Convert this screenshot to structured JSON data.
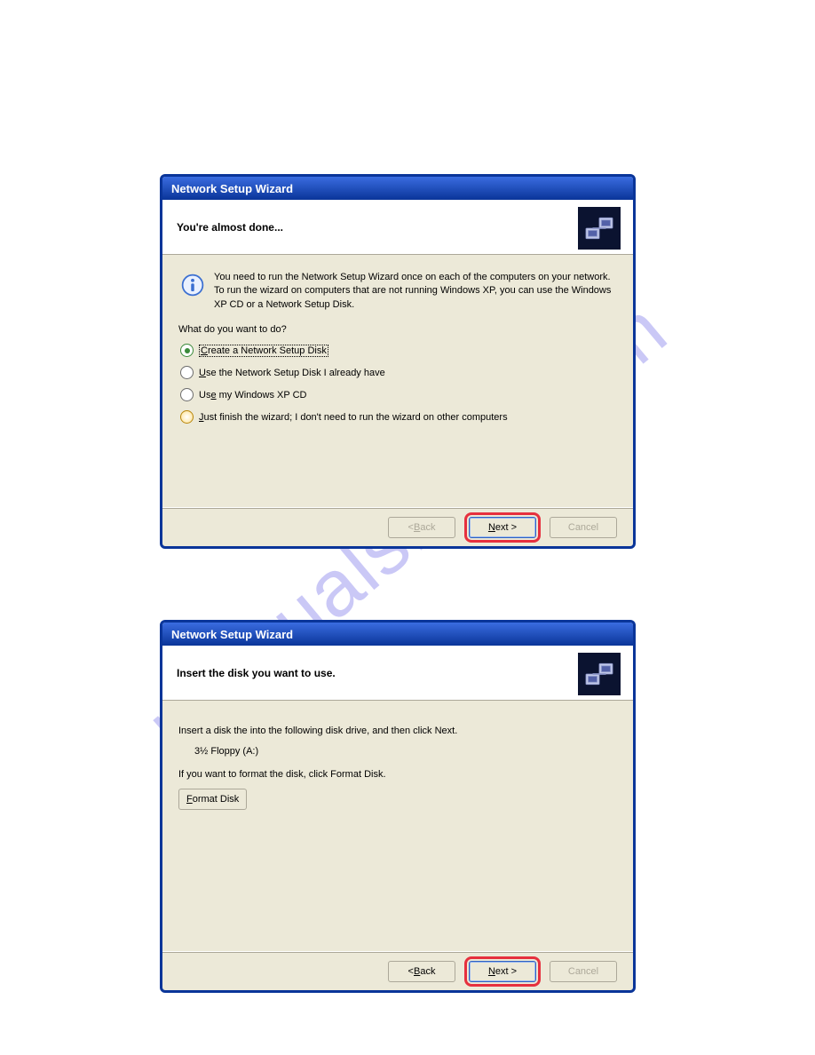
{
  "watermark": "manualshive.com",
  "dialog1": {
    "title": "Network Setup Wizard",
    "headerTitle": "You're almost done...",
    "infoText": "You need to run the Network Setup Wizard once on each of the computers on your network. To run the wizard on computers that are not running Windows XP, you can use the Windows XP CD or a Network Setup Disk.",
    "prompt": "What do you want to do?",
    "options": {
      "o1": {
        "pre": "",
        "u": "C",
        "post": "reate a Network Setup Disk"
      },
      "o2": {
        "pre": "",
        "u": "U",
        "post": "se the Network Setup Disk I already have"
      },
      "o3": {
        "pre": "Us",
        "u": "e",
        "post": " my Windows XP CD"
      },
      "o4": {
        "pre": "",
        "u": "J",
        "post": "ust finish the wizard; I don't need to run the wizard on other computers"
      }
    },
    "buttons": {
      "back": {
        "lt": "< ",
        "u": "B",
        "post": "ack"
      },
      "next": {
        "u": "N",
        "post": "ext >"
      },
      "cancel": "Cancel"
    }
  },
  "dialog2": {
    "title": "Network Setup Wizard",
    "headerTitle": "Insert the disk you want to use.",
    "line1": "Insert a disk the into the following disk drive, and then click Next.",
    "drive": "3½ Floppy (A:)",
    "line2": "If you want to format the disk, click Format Disk.",
    "formatButton": {
      "u": "F",
      "post": "ormat Disk"
    },
    "buttons": {
      "back": {
        "lt": "< ",
        "u": "B",
        "post": "ack"
      },
      "next": {
        "u": "N",
        "post": "ext >"
      },
      "cancel": "Cancel"
    }
  }
}
